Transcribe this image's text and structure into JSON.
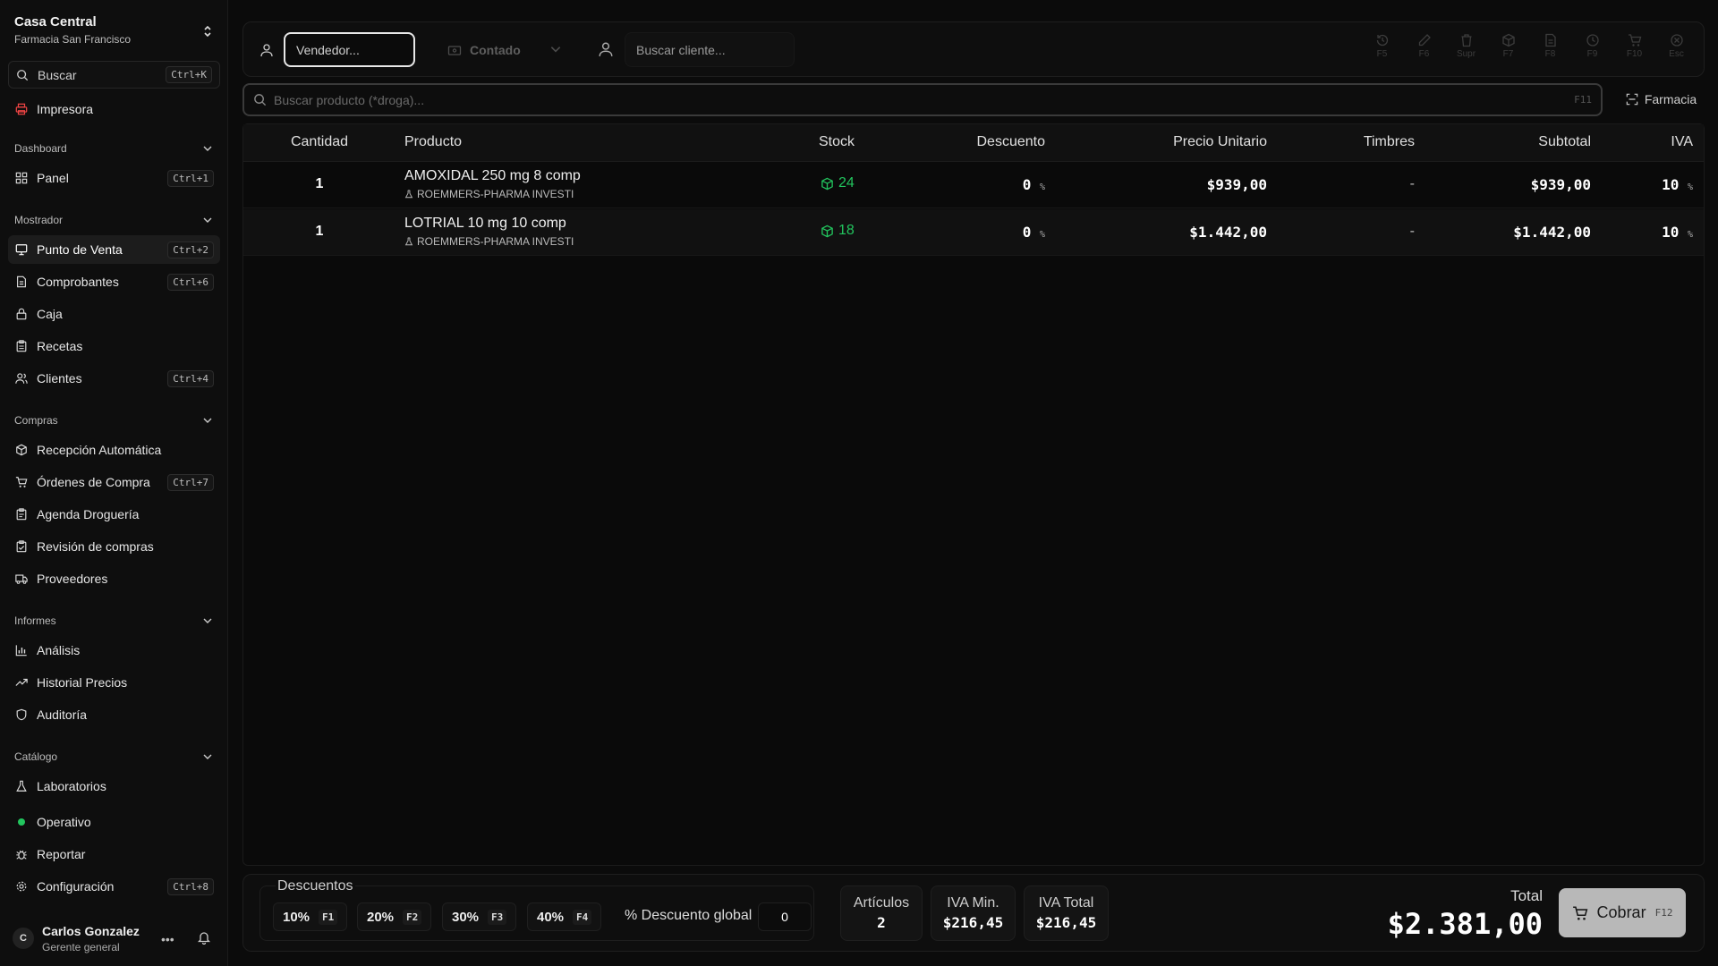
{
  "org": {
    "name": "Casa Central",
    "sub": "Farmacia San Francisco"
  },
  "search": {
    "label": "Buscar",
    "shortcut": "Ctrl+K"
  },
  "printer": {
    "label": "Impresora"
  },
  "sections": {
    "dashboard": "Dashboard",
    "mostrador": "Mostrador",
    "compras": "Compras",
    "informes": "Informes",
    "catalogo": "Catálogo"
  },
  "nav": {
    "panel": {
      "label": "Panel",
      "shortcut": "Ctrl+1"
    },
    "pos": {
      "label": "Punto de Venta",
      "shortcut": "Ctrl+2"
    },
    "comprobantes": {
      "label": "Comprobantes",
      "shortcut": "Ctrl+6"
    },
    "caja": {
      "label": "Caja"
    },
    "recetas": {
      "label": "Recetas"
    },
    "clientes": {
      "label": "Clientes",
      "shortcut": "Ctrl+4"
    },
    "recepcion": {
      "label": "Recepción Automática"
    },
    "ordenes": {
      "label": "Órdenes de Compra",
      "shortcut": "Ctrl+7"
    },
    "agenda": {
      "label": "Agenda Droguería"
    },
    "revision": {
      "label": "Revisión de compras"
    },
    "proveedores": {
      "label": "Proveedores"
    },
    "analisis": {
      "label": "Análisis"
    },
    "historial": {
      "label": "Historial Precios"
    },
    "auditoria": {
      "label": "Auditoría"
    },
    "laboratorios": {
      "label": "Laboratorios"
    }
  },
  "status": {
    "operativo": "Operativo",
    "reportar": "Reportar",
    "config": "Configuración",
    "config_shortcut": "Ctrl+8"
  },
  "user": {
    "initial": "C",
    "name": "Carlos Gonzalez",
    "role": "Gerente general"
  },
  "topbar": {
    "vendedor_placeholder": "Vendedor...",
    "payment": "Contado",
    "cliente_placeholder": "Buscar cliente...",
    "fkeys": [
      "F5",
      "F6",
      "Supr",
      "F7",
      "F8",
      "F9",
      "F10",
      "Esc"
    ]
  },
  "product_search": {
    "placeholder": "Buscar producto (*droga)...",
    "shortcut": "F11"
  },
  "farmacia_btn": "Farmacia",
  "table": {
    "headers": {
      "cantidad": "Cantidad",
      "producto": "Producto",
      "stock": "Stock",
      "descuento": "Descuento",
      "precio": "Precio Unitario",
      "timbres": "Timbres",
      "subtotal": "Subtotal",
      "iva": "IVA"
    },
    "rows": [
      {
        "qty": "1",
        "name": "AMOXIDAL 250 mg 8 comp",
        "lab": "ROEMMERS-PHARMA INVESTI",
        "stock": "24",
        "desc": "0",
        "price": "$939,00",
        "timbres": "-",
        "subtotal": "$939,00",
        "iva": "10"
      },
      {
        "qty": "1",
        "name": "LOTRIAL 10 mg 10 comp",
        "lab": "ROEMMERS-PHARMA INVESTI",
        "stock": "18",
        "desc": "0",
        "price": "$1.442,00",
        "timbres": "-",
        "subtotal": "$1.442,00",
        "iva": "10"
      }
    ],
    "pct": "%"
  },
  "footer": {
    "descuentos_title": "Descuentos",
    "discounts": [
      {
        "label": "10%",
        "key": "F1"
      },
      {
        "label": "20%",
        "key": "F2"
      },
      {
        "label": "30%",
        "key": "F3"
      },
      {
        "label": "40%",
        "key": "F4"
      }
    ],
    "global_label": "% Descuento global",
    "global_value": "0",
    "articulos_label": "Artículos",
    "articulos_value": "2",
    "iva_min_label": "IVA Min.",
    "iva_min_value": "$216,45",
    "iva_total_label": "IVA Total",
    "iva_total_value": "$216,45",
    "total_label": "Total",
    "total_value": "$2.381,00",
    "cobrar_label": "Cobrar",
    "cobrar_key": "F12"
  },
  "colors": {
    "accent_green": "#22c55e",
    "printer_red": "#ef4444"
  }
}
